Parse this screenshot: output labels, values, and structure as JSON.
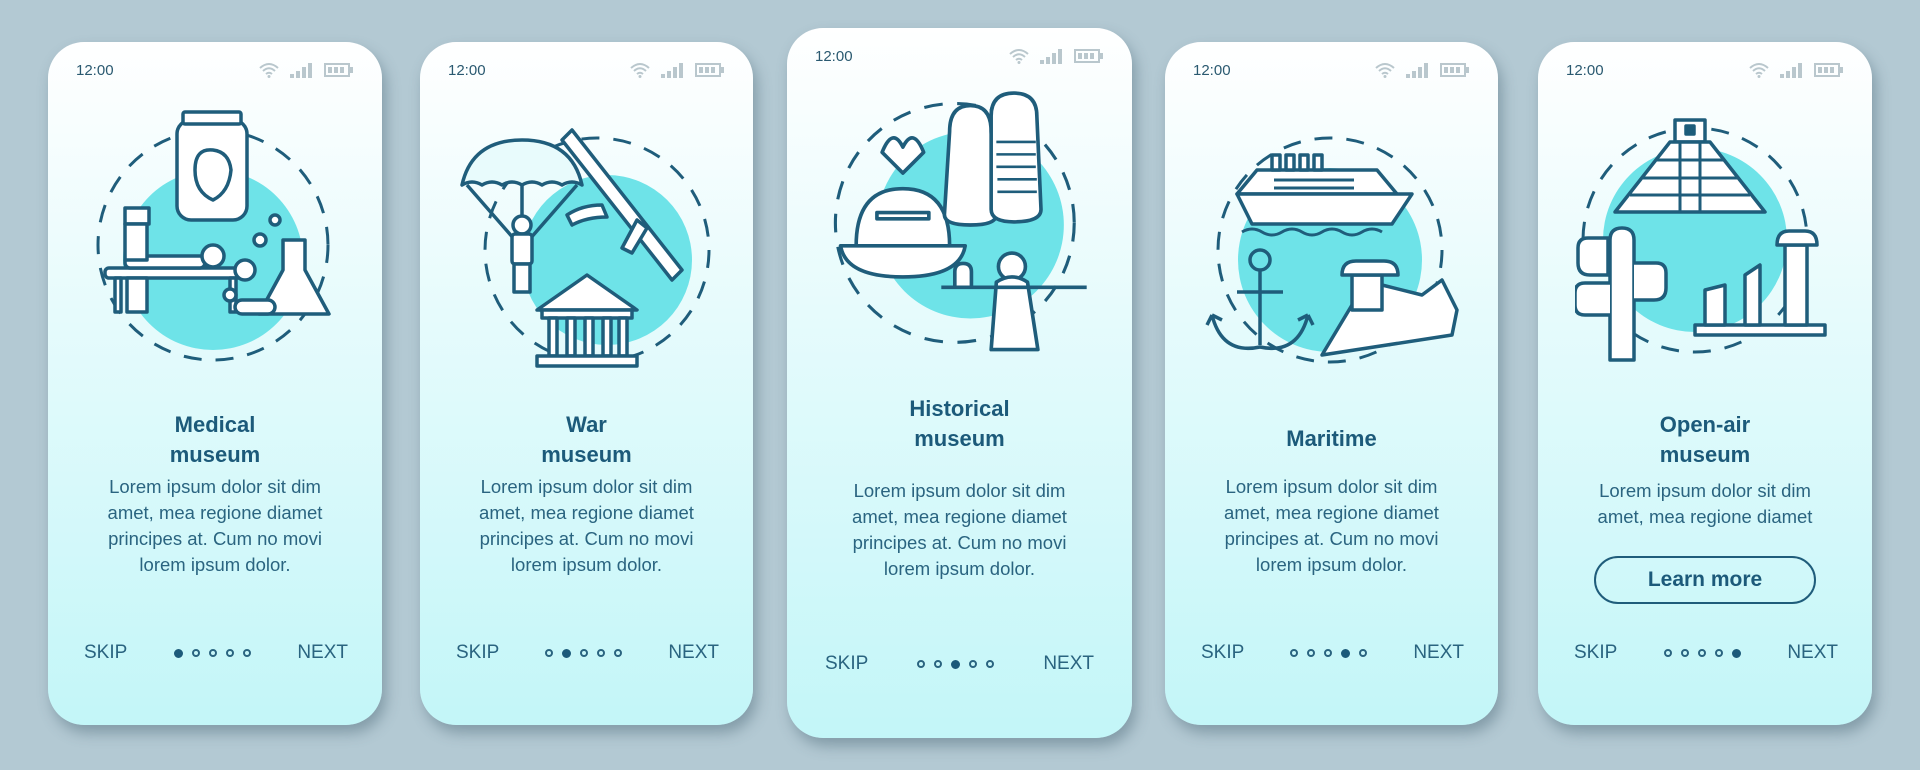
{
  "colors": {
    "background": "#b3c9d3",
    "accent_circle": "#6ee3e8",
    "stroke": "#1f5d7b",
    "title_text": "#1c5a7a",
    "body_text": "#2a6480"
  },
  "status_bar": {
    "time": "12:00",
    "icons": [
      "wifi-icon",
      "signal-icon",
      "battery-icon"
    ]
  },
  "cards": [
    {
      "illustration": "medical-museum-illustration",
      "title_line1": "Medical",
      "title_line2": "museum",
      "body": [
        "Lorem ipsum dolor sit dim",
        "amet, mea regione diamet",
        "principes at. Cum no movi",
        "lorem ipsum dolor."
      ],
      "skip": "SKIP",
      "next": "NEXT",
      "page_index": 1,
      "page_count": 5
    },
    {
      "illustration": "war-museum-illustration",
      "title_line1": "War",
      "title_line2": "museum",
      "body": [
        "Lorem ipsum dolor sit dim",
        "amet, mea regione diamet",
        "principes at. Cum no movi",
        "lorem ipsum dolor."
      ],
      "skip": "SKIP",
      "next": "NEXT",
      "page_index": 2,
      "page_count": 5
    },
    {
      "illustration": "historical-museum-illustration",
      "title_line1": "Historical",
      "title_line2": "museum",
      "body": [
        "Lorem ipsum dolor sit dim",
        "amet, mea regione diamet",
        "principes at. Cum no movi",
        "lorem ipsum dolor."
      ],
      "skip": "SKIP",
      "next": "NEXT",
      "page_index": 3,
      "page_count": 5
    },
    {
      "illustration": "maritime-museum-illustration",
      "title_line1": "Maritime",
      "title_line2": "",
      "body": [
        "Lorem ipsum dolor sit dim",
        "amet, mea regione diamet",
        "principes at. Cum no movi",
        "lorem ipsum dolor."
      ],
      "skip": "SKIP",
      "next": "NEXT",
      "page_index": 4,
      "page_count": 5
    },
    {
      "illustration": "open-air-museum-illustration",
      "title_line1": "Open-air",
      "title_line2": "museum",
      "body": [
        "Lorem ipsum dolor sit dim",
        "amet, mea regione diamet"
      ],
      "button": "Learn more",
      "skip": "SKIP",
      "next": "NEXT",
      "page_index": 5,
      "page_count": 5
    }
  ]
}
